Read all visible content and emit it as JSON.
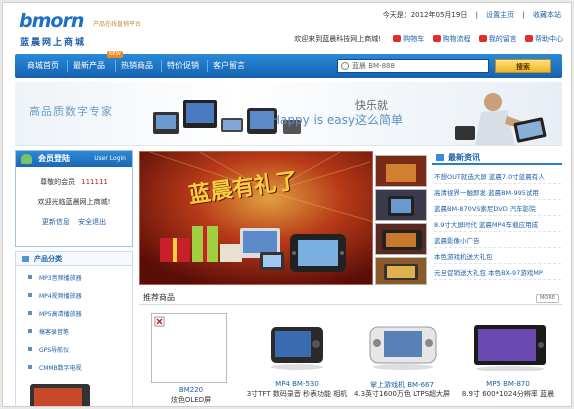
{
  "logo": {
    "en": "bmorn",
    "slogan": "产品在线直销平台",
    "cn": "蓝晨网上商城"
  },
  "toplinks": {
    "date": "今天是：2012年05月19日",
    "home": "设置主页",
    "fav": "收藏本站"
  },
  "welcome": {
    "text": "欢迎来到蓝晨科技网上商城!",
    "links": [
      "购物车",
      "购物流程",
      "我的留言",
      "帮助中心"
    ]
  },
  "nav": {
    "items": [
      "商城首页",
      "最新产品",
      "热销商品",
      "特价促销",
      "客户留言"
    ],
    "new_tag": "NEW",
    "search_value": "蓝晨 BM-888",
    "search_button": "搜索"
  },
  "banner": {
    "left": "高品质数字专家",
    "right1": "快乐就",
    "right2": "Happy is easy这么简单"
  },
  "member": {
    "title": "会员登陆",
    "login": "User Login",
    "greet": "尊敬的会员",
    "id": "111111",
    "welcome": "欢迎光临蓝晨网上商城!",
    "links": [
      "更新信息",
      "安全退出"
    ]
  },
  "category": {
    "title": "产品分类",
    "items": [
      "MP3音频播放器",
      "MP4视频播放器",
      "MP5高清播放器",
      "搞客录音笔",
      "GPS导航仪",
      "CMMB数字电视"
    ]
  },
  "feature": {
    "text": "蓝晨有礼了"
  },
  "news": {
    "title": "最新资讯",
    "items": [
      "不想OUT就选大屏 蓝晨7.0寸蓝晨有人",
      "高清视界一触即发 蓝晨BM-995试用",
      "蓝晨BM-870VS索尼DVD 汽车影院",
      "8.9寸大屏时代 蓝晨MP4车载应用成",
      "蓝晨影像小广告",
      "本色游戏机送大礼包",
      "元旦促销送大礼包 本色BX-97游戏MP"
    ]
  },
  "recommend": {
    "title": "推荐商品",
    "more": "MORE",
    "products": [
      {
        "name": "BM220",
        "desc": "炫色OLED屏"
      },
      {
        "name": "MP4 BM-530",
        "desc": "3寸TFT 数码录音 秒表功能 相机"
      },
      {
        "name": "掌上游戏机 BM-667",
        "desc": "4.3英寸1600万色 LTPS超大屏"
      },
      {
        "name": "MP5 BM-870",
        "desc": "8.9寸 600*1024分辨率 蓝晨"
      }
    ]
  },
  "colors": {
    "primary": "#1d5fa8",
    "nav": "#1a6ec0",
    "accent": "#f0b428"
  }
}
